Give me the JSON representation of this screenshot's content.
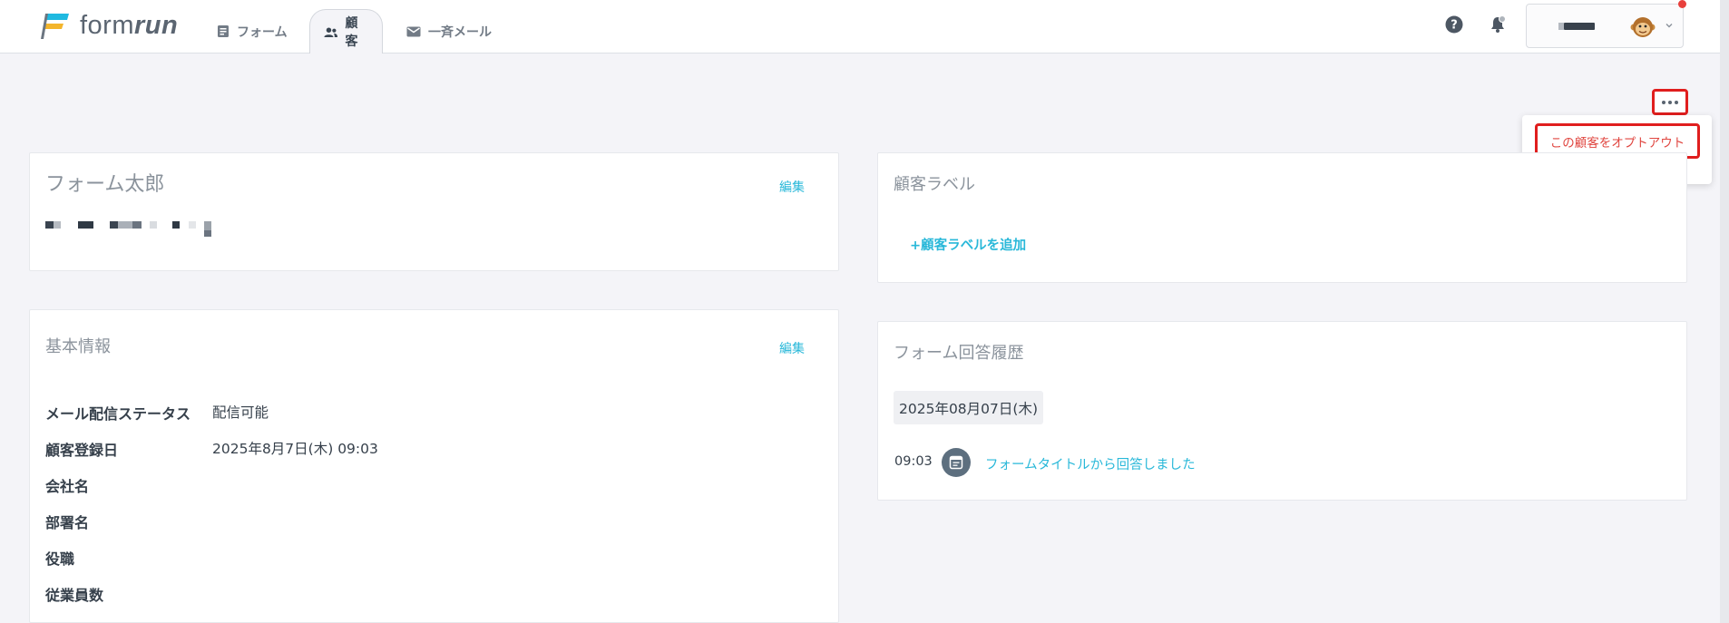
{
  "brand": {
    "logo_text_regular": "form",
    "logo_text_bold": "run",
    "colors": {
      "accent": "#29b8d9",
      "alert": "#e01e1e"
    }
  },
  "nav": {
    "tabs": [
      {
        "label": "フォーム",
        "icon": "document-icon",
        "active": false
      },
      {
        "label": "顧客",
        "icon": "people-icon",
        "active": true
      },
      {
        "label": "一斉メール",
        "icon": "mail-icon",
        "active": false
      }
    ]
  },
  "header_icons": {
    "help": "help-icon",
    "notifications": "bell-icon",
    "account_menu": "chevron-down-icon"
  },
  "more_menu": {
    "button_icon": "ellipsis-icon",
    "items": [
      {
        "label": "この顧客をオプトアウト"
      }
    ]
  },
  "customer_card": {
    "name": "フォーム太郎",
    "edit_label": "編集"
  },
  "label_card": {
    "title": "顧客ラベル",
    "add_label": "+顧客ラベルを追加"
  },
  "basic_info": {
    "title": "基本情報",
    "edit_label": "編集",
    "rows": [
      {
        "label": "メール配信ステータス",
        "value": "配信可能"
      },
      {
        "label": "顧客登録日",
        "value": "2025年8月7日(木) 09:03"
      },
      {
        "label": "会社名",
        "value": ""
      },
      {
        "label": "部署名",
        "value": ""
      },
      {
        "label": "役職",
        "value": ""
      },
      {
        "label": "従業員数",
        "value": ""
      }
    ]
  },
  "history": {
    "title": "フォーム回答履歴",
    "date": "2025年08月07日(木)",
    "entries": [
      {
        "time": "09:03",
        "text": "フォームタイトルから回答しました",
        "icon": "form-icon"
      }
    ]
  }
}
